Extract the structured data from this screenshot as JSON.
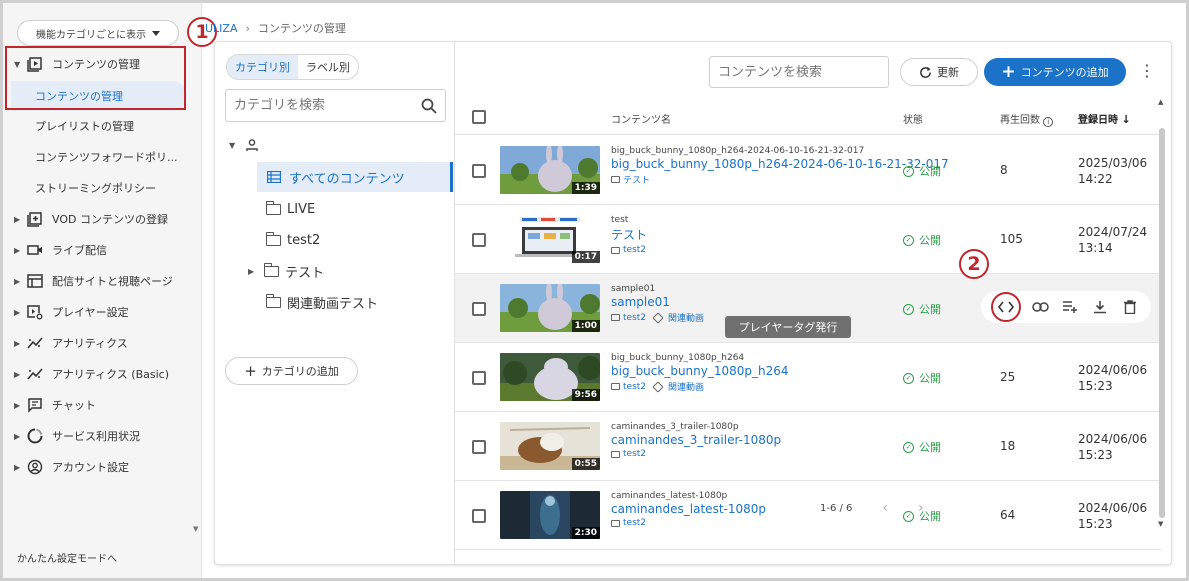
{
  "sidebar": {
    "category_toggle": "機能カテゴリごとに表示",
    "items": [
      {
        "label": "コンテンツの管理",
        "icon": "content-manage-icon",
        "expanded": true,
        "children": [
          "コンテンツの管理",
          "プレイリストの管理",
          "コンテンツフォワードポリ...",
          "ストリーミングポリシー"
        ]
      },
      {
        "label": "VOD コンテンツの登録",
        "icon": "vod-register-icon"
      },
      {
        "label": "ライブ配信",
        "icon": "live-camera-icon"
      },
      {
        "label": "配信サイトと視聴ページ",
        "icon": "site-icon"
      },
      {
        "label": "プレイヤー設定",
        "icon": "player-settings-icon"
      },
      {
        "label": "アナリティクス",
        "icon": "analytics-icon"
      },
      {
        "label": "アナリティクス (Basic)",
        "icon": "analytics-icon"
      },
      {
        "label": "チャット",
        "icon": "chat-icon"
      },
      {
        "label": "サービス利用状況",
        "icon": "usage-icon"
      },
      {
        "label": "アカウント設定",
        "icon": "account-icon"
      }
    ],
    "easy_mode": "かんたん設定モードへ"
  },
  "breadcrumb": {
    "home": "ULIZA",
    "current": "コンテンツの管理"
  },
  "category_panel": {
    "tabs": [
      "カテゴリ別",
      "ラベル別"
    ],
    "search_placeholder": "カテゴリを検索",
    "tree": [
      "すべてのコンテンツ",
      "LIVE",
      "test2",
      "テスト",
      "関連動画テスト"
    ],
    "add_label": "カテゴリの追加"
  },
  "toolbar": {
    "search_placeholder": "コンテンツを検索",
    "refresh_label": "更新",
    "add_label": "コンテンツの追加"
  },
  "table": {
    "headers": {
      "name": "コンテンツ名",
      "status": "状態",
      "plays": "再生回数",
      "date": "登録日時"
    },
    "rows": [
      {
        "file": "big_buck_bunny_1080p_h264-2024-06-10-16-21-32-017",
        "title": "big_buck_bunny_1080p_h264-2024-06-10-16-21-32-017",
        "folder": "テスト",
        "tag": "",
        "duration": "1:39",
        "status": "公開",
        "plays": "8",
        "date1": "2025/03/06",
        "date2": "14:22",
        "thumb": "bunny"
      },
      {
        "file": "test",
        "title": "テスト",
        "folder": "test2",
        "tag": "",
        "duration": "0:17",
        "status": "公開",
        "plays": "105",
        "date1": "2024/07/24",
        "date2": "13:14",
        "thumb": "screen"
      },
      {
        "file": "sample01",
        "title": "sample01",
        "folder": "test2",
        "tag": "関連動画",
        "duration": "1:00",
        "status": "公開",
        "plays": "",
        "date1": "",
        "date2": "",
        "thumb": "bunny"
      },
      {
        "file": "big_buck_bunny_1080p_h264",
        "title": "big_buck_bunny_1080p_h264",
        "folder": "test2",
        "tag": "関連動画",
        "duration": "9:56",
        "status": "公開",
        "plays": "25",
        "date1": "2024/06/06",
        "date2": "15:23",
        "thumb": "bunny2"
      },
      {
        "file": "caminandes_3_trailer-1080p",
        "title": "caminandes_3_trailer-1080p",
        "folder": "test2",
        "tag": "",
        "duration": "0:55",
        "status": "公開",
        "plays": "18",
        "date1": "2024/06/06",
        "date2": "15:23",
        "thumb": "llama"
      },
      {
        "file": "caminandes_latest-1080p",
        "title": "caminandes_latest-1080p",
        "folder": "test2",
        "tag": "",
        "duration": "2:30",
        "status": "公開",
        "plays": "64",
        "date1": "2024/06/06",
        "date2": "15:23",
        "thumb": "dark"
      }
    ]
  },
  "row_actions": {
    "icons": [
      "embed-code-icon",
      "link-icon",
      "playlist-add-icon",
      "download-icon",
      "delete-icon"
    ],
    "tooltip": "プレイヤータグ発行"
  },
  "pager": {
    "range": "1-6 / 6"
  },
  "callouts": [
    "1",
    "2"
  ],
  "colors": {
    "accent": "#1a73c8",
    "callout": "#c0272d",
    "status_ok": "#2e9e4a"
  }
}
